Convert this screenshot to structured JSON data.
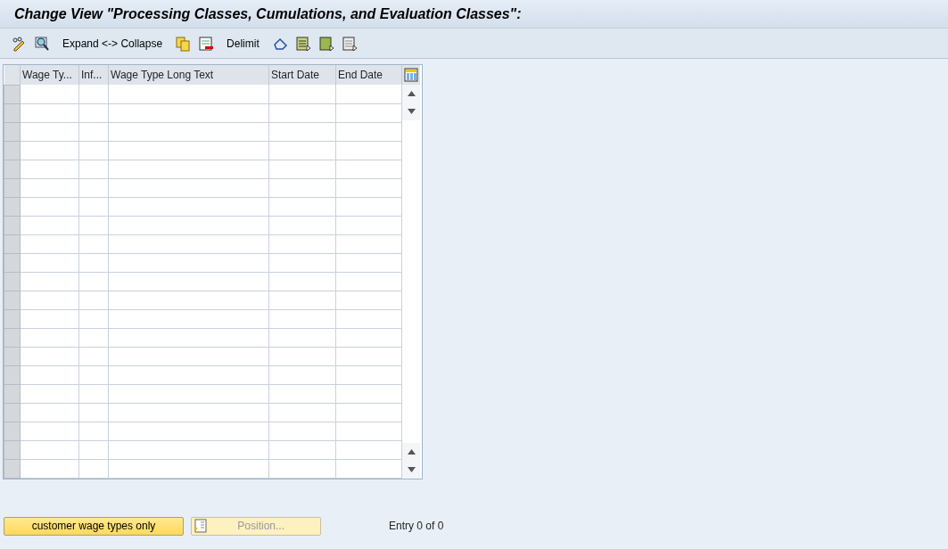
{
  "window": {
    "title": "Change View \"Processing Classes, Cumulations, and Evaluation Classes\":"
  },
  "toolbar": [
    {
      "kind": "icon"
    },
    {
      "kind": "icon"
    },
    {
      "kind": "text",
      "label": "Expand <-> Collapse"
    },
    {
      "kind": "icon"
    },
    {
      "kind": "icon"
    },
    {
      "kind": "text",
      "label": "Delimit"
    },
    {
      "kind": "icon"
    },
    {
      "kind": "icon"
    },
    {
      "kind": "icon"
    },
    {
      "kind": "icon"
    }
  ],
  "table": {
    "columns": [
      "Wage Ty...",
      "Inf...",
      "Wage Type Long Text",
      "Start Date",
      "End Date"
    ]
  },
  "buttons": [
    {
      "label": "customer wage types only",
      "disabled": false
    },
    {
      "label": "Position...",
      "disabled": true
    }
  ],
  "entry_info": "Entry 0 of 0"
}
